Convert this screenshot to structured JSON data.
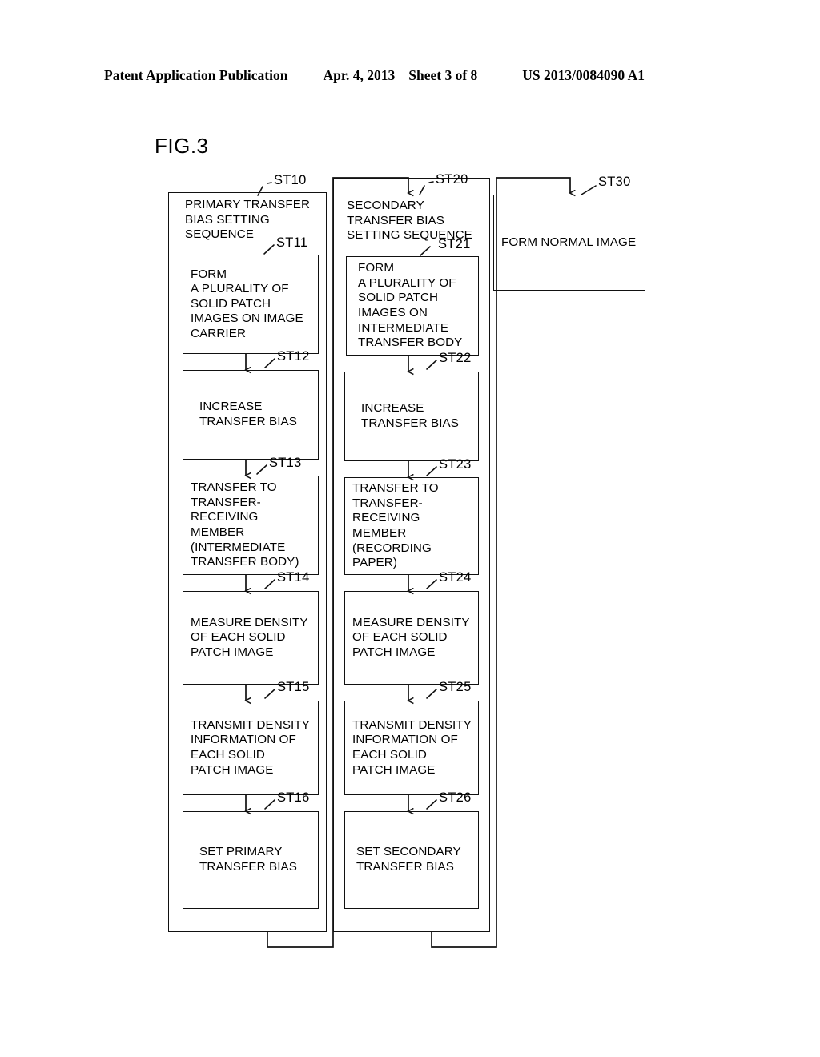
{
  "header": {
    "publication": "Patent Application Publication",
    "date": "Apr. 4, 2013",
    "sheet": "Sheet 3 of 8",
    "number": "US 2013/0084090 A1"
  },
  "figure": {
    "label": "FIG.3"
  },
  "flowchart": {
    "columns": [
      {
        "id": "primary-transfer-column",
        "header": {
          "tag": "ST10",
          "text": "PRIMARY TRANSFER\nBIAS SETTING\nSEQUENCE"
        },
        "steps": [
          {
            "tag": "ST11",
            "text": "FORM\nA PLURALITY OF\nSOLID PATCH\nIMAGES ON IMAGE\nCARRIER"
          },
          {
            "tag": "ST12",
            "text": "INCREASE\nTRANSFER BIAS"
          },
          {
            "tag": "ST13",
            "text": "TRANSFER TO\nTRANSFER-\nRECEIVING\nMEMBER\n(INTERMEDIATE\nTRANSFER BODY)"
          },
          {
            "tag": "ST14",
            "text": "MEASURE DENSITY\nOF EACH SOLID\nPATCH IMAGE"
          },
          {
            "tag": "ST15",
            "text": "TRANSMIT DENSITY\nINFORMATION OF\nEACH SOLID\nPATCH IMAGE"
          },
          {
            "tag": "ST16",
            "text": "SET PRIMARY\nTRANSFER BIAS"
          }
        ]
      },
      {
        "id": "secondary-transfer-column",
        "header": {
          "tag": "ST20",
          "text": "SECONDARY\nTRANSFER BIAS\nSETTING SEQUENCE"
        },
        "steps": [
          {
            "tag": "ST21",
            "text": "FORM\nA PLURALITY OF\nSOLID PATCH\nIMAGES ON\nINTERMEDIATE\nTRANSFER BODY"
          },
          {
            "tag": "ST22",
            "text": "INCREASE\nTRANSFER BIAS"
          },
          {
            "tag": "ST23",
            "text": "TRANSFER TO\nTRANSFER-\nRECEIVING\nMEMBER\n (RECORDING PAPER)"
          },
          {
            "tag": "ST24",
            "text": "MEASURE DENSITY\nOF EACH SOLID\nPATCH IMAGE"
          },
          {
            "tag": "ST25",
            "text": "TRANSMIT DENSITY\nINFORMATION OF\nEACH SOLID\nPATCH IMAGE"
          },
          {
            "tag": "ST26",
            "text": "SET SECONDARY\nTRANSFER BIAS"
          }
        ]
      },
      {
        "id": "normal-image-column",
        "header": null,
        "steps": [
          {
            "tag": "ST30",
            "text": "FORM NORMAL IMAGE"
          }
        ]
      }
    ]
  }
}
